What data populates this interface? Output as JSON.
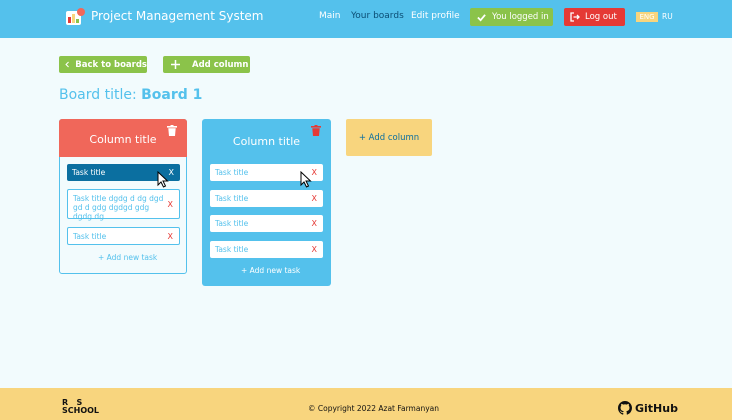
{
  "header": {
    "title": "Project Management System",
    "nav": [
      {
        "label": "Main",
        "active": false
      },
      {
        "label": "Your boards",
        "active": true
      },
      {
        "label": "Edit profile",
        "active": false
      }
    ],
    "logged_in": "You logged in",
    "logout": "Log out",
    "languages": [
      "ENG",
      "RU"
    ],
    "selected_language": "ENG"
  },
  "toolbar": {
    "back_label": "Back to boards",
    "add_column_label": "Add column"
  },
  "board": {
    "title_prefix": "Board title:",
    "title_value": "Board 1",
    "columns": [
      {
        "title": "Column title",
        "tasks": [
          {
            "title": "Task title",
            "close": "X"
          },
          {
            "title": "Task title dgdg d dg  dgd gd d gdg dgdgd gdg dgdg dg",
            "close": "X"
          },
          {
            "title": "Task title",
            "close": "X"
          }
        ],
        "add_task": "+ Add new task"
      },
      {
        "title": "Column title",
        "tasks": [
          {
            "title": "Task title",
            "close": "X"
          },
          {
            "title": "Task title",
            "close": "X"
          },
          {
            "title": "Task title",
            "close": "X"
          },
          {
            "title": "Task title",
            "close": "X"
          }
        ],
        "add_task": "+ Add new task"
      }
    ],
    "add_column": "+ Add column"
  },
  "footer": {
    "logo_lines": [
      "R   S",
      "SCHOOL"
    ],
    "copyright": "© Copyright 2022 Azat Farmanyan",
    "github": "GitHub"
  },
  "colors": {
    "header": "#54c1ec",
    "accent_green": "#8bc34a",
    "danger": "#e53935",
    "column_header": "#f0675a",
    "footer": "#f8d57e",
    "task_active": "#0b6fa0"
  },
  "icons": [
    "app-logo-icon",
    "check-icon",
    "logout-icon",
    "chevron-left-icon",
    "plus-icon",
    "trash-icon",
    "cursor-icon",
    "github-icon"
  ]
}
